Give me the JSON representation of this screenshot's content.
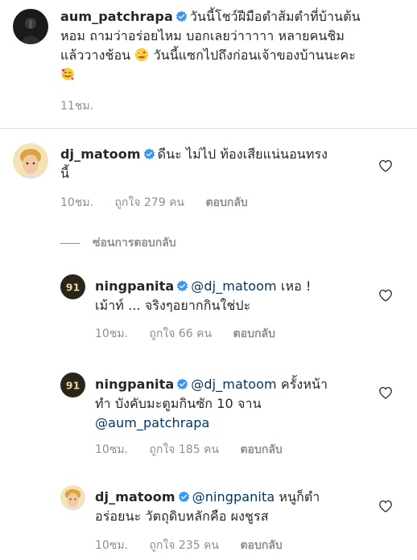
{
  "caption": {
    "username": "aum_patchrapa",
    "line1": "วันนี้โชว์ฝีมือตำส้มตำที่บ้านต้น",
    "line2": "หอม ถามว่าอร่อยไหม บอกเลยว่าาาาา หลายคนชิม",
    "line3": "แล้ววางช้อน",
    "line3b": "วันนี้แซกไปถึงก่อนเจ้าของบ้านนะคะ",
    "time": "11ชม."
  },
  "comments": [
    {
      "username": "dj_matoom",
      "line1": "ดีนะ ไม่ไป ท้องเสียแน่นอนทรง",
      "line2": "นี้",
      "time": "10ชม.",
      "likes": "ถูกใจ 279 คน",
      "reply": "ตอบกลับ"
    }
  ],
  "hide_replies": "ซ่อนการตอบกลับ",
  "replies": [
    {
      "username": "ningpanita",
      "mention": "@dj_matoom",
      "line1_rest": "เหอ !",
      "line2": "เม้าท์ ... จริงๆอยากกินใช่ปะ",
      "time": "10ชม.",
      "likes": "ถูกใจ 66 คน",
      "reply": "ตอบกลับ"
    },
    {
      "username": "ningpanita",
      "mention": "@dj_matoom",
      "line1_rest": "ครั้งหน้า",
      "line2": "ทำ บังคับมะตูมกินซัก 10 จาน",
      "line3": "@aum_patchrapa",
      "time": "10ชม.",
      "likes": "ถูกใจ 185 คน",
      "reply": "ตอบกลับ"
    },
    {
      "username": "dj_matoom",
      "mention": "@ningpanita",
      "line1_rest": "หนูก็ตำ",
      "line2": "อร่อยนะ วัตถุดิบหลักคือ ผงชูรส",
      "time": "10ชม.",
      "likes": "ถูกใจ 235 คน",
      "reply": "ตอบกลับ"
    }
  ],
  "colors": {
    "verified": "#3897f0",
    "mention": "#003569",
    "meta": "#8e8e8e"
  }
}
